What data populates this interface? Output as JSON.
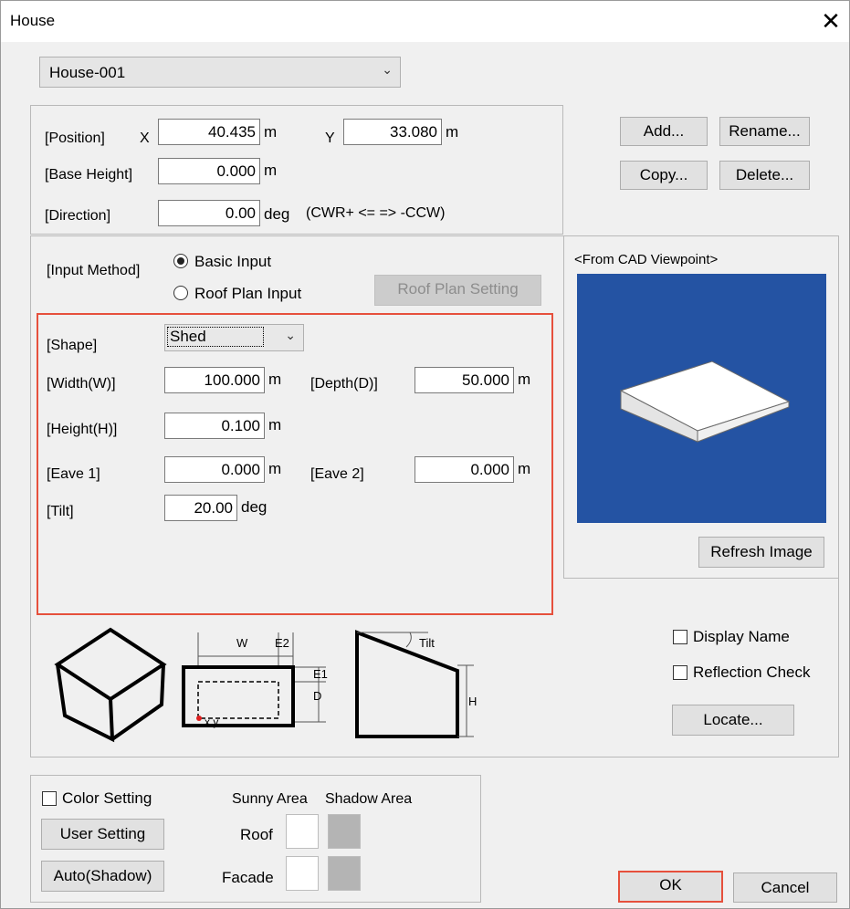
{
  "window": {
    "title": "House",
    "close_glyph": "✕"
  },
  "house_select": {
    "value": "House-001"
  },
  "position": {
    "label": "[Position]",
    "x_label": "X",
    "x_value": "40.435",
    "x_unit": "m",
    "y_label": "Y",
    "y_value": "33.080",
    "y_unit": "m"
  },
  "base_height": {
    "label": "[Base Height]",
    "value": "0.000",
    "unit": "m"
  },
  "direction": {
    "label": "[Direction]",
    "value": "0.00",
    "unit": "deg",
    "note": "(CWR+ <= => -CCW)"
  },
  "house_buttons": {
    "add": "Add...",
    "rename": "Rename...",
    "copy": "Copy...",
    "delete": "Delete..."
  },
  "input_method": {
    "label": "[Input Method]",
    "basic": "Basic Input",
    "roof_plan": "Roof Plan Input",
    "selected": "basic",
    "roof_plan_setting": "Roof Plan Setting"
  },
  "shape": {
    "label": "[Shape]",
    "value": "Shed",
    "width_label": "[Width(W)]",
    "width_value": "100.000",
    "width_unit": "m",
    "depth_label": "[Depth(D)]",
    "depth_value": "50.000",
    "depth_unit": "m",
    "height_label": "[Height(H)]",
    "height_value": "0.100",
    "height_unit": "m",
    "eave1_label": "[Eave 1]",
    "eave1_value": "0.000",
    "eave1_unit": "m",
    "eave2_label": "[Eave 2]",
    "eave2_value": "0.000",
    "eave2_unit": "m",
    "tilt_label": "[Tilt]",
    "tilt_value": "20.00",
    "tilt_unit": "deg"
  },
  "diagram": {
    "w": "W",
    "e2": "E2",
    "e1": "E1",
    "d": "D",
    "xy": "x,y",
    "tilt": "Tilt",
    "h": "H"
  },
  "preview": {
    "label": "<From CAD Viewpoint>",
    "refresh": "Refresh Image",
    "bg_color": "#2453a3"
  },
  "options": {
    "display_name": "Display Name",
    "reflection_check": "Reflection Check",
    "locate": "Locate..."
  },
  "color": {
    "checkbox_label": "Color Setting",
    "user_setting": "User Setting",
    "auto_shadow": "Auto(Shadow)",
    "sunny_area": "Sunny Area",
    "shadow_area": "Shadow Area",
    "roof": "Roof",
    "facade": "Facade",
    "sunny_color": "#ffffff",
    "shadow_color": "#b4b4b4"
  },
  "footer": {
    "ok": "OK",
    "cancel": "Cancel"
  },
  "colors": {
    "highlight": "#e6503c"
  }
}
